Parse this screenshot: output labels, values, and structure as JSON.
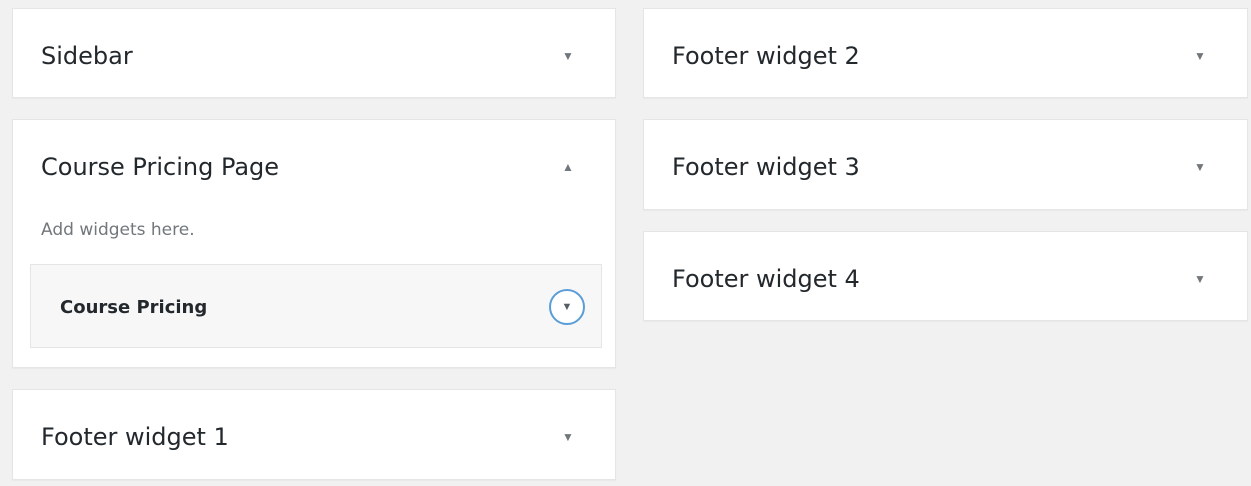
{
  "colors": {
    "background": "#f1f1f1",
    "panel": "#ffffff",
    "focus_ring": "#5b9dd9",
    "arrow": "#72777c"
  },
  "left_column": {
    "sidebar": {
      "title": "Sidebar",
      "toggle_icon": "triangle-down-icon",
      "toggle_glyph": "▼"
    },
    "course_pricing_page": {
      "title": "Course Pricing Page",
      "toggle_icon": "triangle-up-icon",
      "toggle_glyph": "▲",
      "description": "Add widgets here.",
      "widgets": [
        {
          "title": "Course Pricing",
          "toggle_icon": "chevron-down-circle-icon",
          "toggle_glyph": "▼"
        }
      ]
    },
    "footer_widget_1": {
      "title": "Footer widget 1",
      "toggle_icon": "triangle-down-icon",
      "toggle_glyph": "▼"
    }
  },
  "right_column": {
    "footer_widget_2": {
      "title": "Footer widget 2",
      "toggle_icon": "triangle-down-icon",
      "toggle_glyph": "▼"
    },
    "footer_widget_3": {
      "title": "Footer widget 3",
      "toggle_icon": "triangle-down-icon",
      "toggle_glyph": "▼"
    },
    "footer_widget_4": {
      "title": "Footer widget 4",
      "toggle_icon": "triangle-down-icon",
      "toggle_glyph": "▼"
    }
  }
}
